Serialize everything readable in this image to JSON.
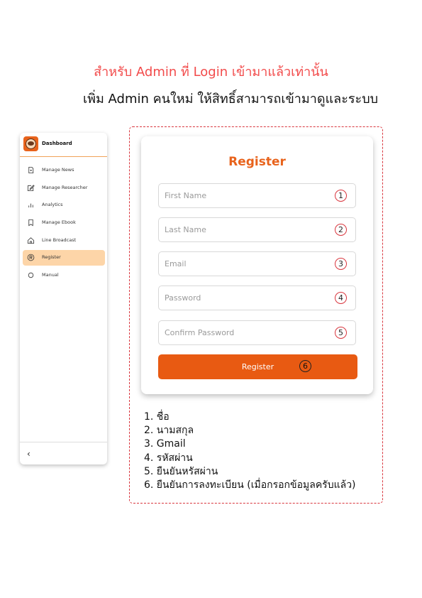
{
  "headings": {
    "admin_only": "สำหรับ Admin ที่ Login เข้ามาแล้วเท่านั้น",
    "add_admin": "เพิ่ม Admin คนใหม่ ให้สิทธิ์สามารถเข้ามาดูและระบบ"
  },
  "colors": {
    "accent": "#e85a12",
    "heading_red": "#f24b4b",
    "sidebar_active_bg": "#fdd5a8",
    "dashed_border": "#d9363e"
  },
  "sidebar": {
    "title": "Dashboard",
    "logo_icon": "logo-icon",
    "items": [
      {
        "label": "Manage News",
        "icon": "news-icon"
      },
      {
        "label": "Manage Researcher",
        "icon": "edit-icon"
      },
      {
        "label": "Analytics",
        "icon": "bar-chart-icon"
      },
      {
        "label": "Manage Ebook",
        "icon": "bookmark-icon"
      },
      {
        "label": "Line Broadcast",
        "icon": "home-icon"
      },
      {
        "label": "Register",
        "icon": "registered-icon",
        "active": true
      },
      {
        "label": "Manual",
        "icon": "circle-icon"
      }
    ],
    "collapse_label": "‹"
  },
  "form": {
    "title": "Register",
    "fields": [
      {
        "placeholder": "First Name",
        "num": "1"
      },
      {
        "placeholder": "Last Name",
        "num": "2"
      },
      {
        "placeholder": "Email",
        "num": "3"
      },
      {
        "placeholder": "Password",
        "num": "4"
      },
      {
        "placeholder": "Confirm Password",
        "num": "5"
      }
    ],
    "button_label": "Register",
    "button_num": "6"
  },
  "notes": [
    "1. ชื่อ",
    "2. นามสกุล",
    "3. Gmail",
    "4. รหัสผ่าน",
    "5. ยืนยันหรัสผ่าน",
    "6. ยืนยันการลงทะเบียน (เมื่อกรอกข้อมูลครับแล้ว)"
  ]
}
